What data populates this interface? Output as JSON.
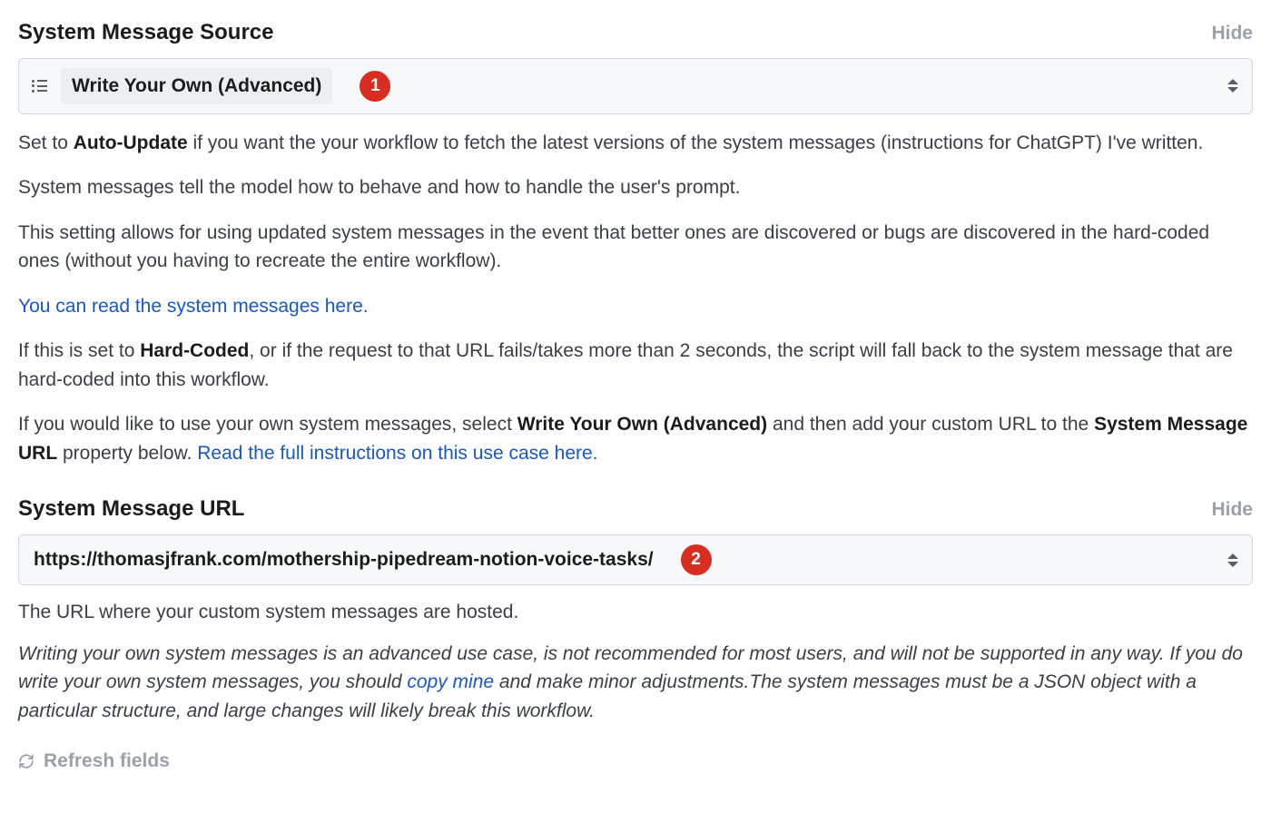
{
  "section1": {
    "title": "System Message Source",
    "hide": "Hide",
    "select_value": "Write Your Own (Advanced)",
    "annot": "1",
    "desc": {
      "p1_a": "Set to ",
      "p1_bold": "Auto-Update",
      "p1_b": " if you want the your workflow to fetch the latest versions of the system messages (instructions for ChatGPT) I've written.",
      "p2": "System messages tell the model how to behave and how to handle the user's prompt.",
      "p3": "This setting allows for using updated system messages in the event that better ones are discovered or bugs are discovered in the hard-coded ones (without you having to recreate the entire workflow).",
      "p4_link": "You can read the system messages here.",
      "p5_a": "If this is set to ",
      "p5_bold": "Hard-Coded",
      "p5_b": ", or if the request to that URL fails/takes more than 2 seconds, the script will fall back to the system message that are hard-coded into this workflow.",
      "p6_a": "If you would like to use your own system messages, select ",
      "p6_bold1": "Write Your Own (Advanced)",
      "p6_b": " and then add your custom URL to the ",
      "p6_bold2": "System Message URL",
      "p6_c": " property below. ",
      "p6_link": "Read the full instructions on this use case here."
    }
  },
  "section2": {
    "title": "System Message URL",
    "hide": "Hide",
    "value": "https://thomasjfrank.com/mothership-pipedream-notion-voice-tasks/",
    "annot": "2",
    "desc": {
      "p1": "The URL where your custom system messages are hosted.",
      "p2_a": "Writing your own system messages is an advanced use case, is not recommended for most users, and will not be supported in any way. If you do write your own system messages, you should ",
      "p2_link": "copy mine",
      "p2_b": " and make minor adjustments.The system messages must be a JSON object with a particular structure, and large changes will likely break this workflow."
    }
  },
  "refresh_label": "Refresh fields"
}
